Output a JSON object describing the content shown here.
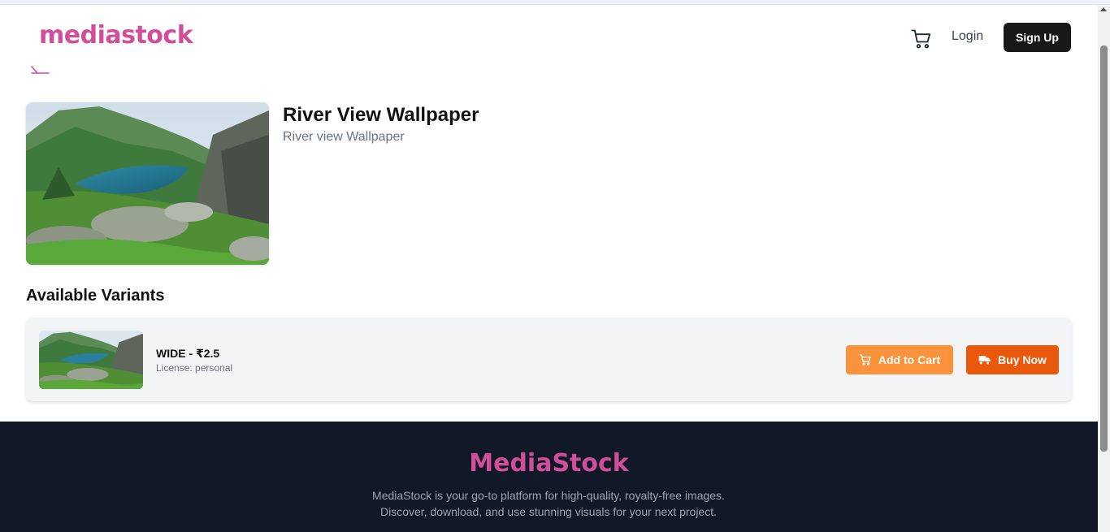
{
  "header": {
    "logo": "mediastock",
    "login_label": "Login",
    "signup_label": "Sign Up"
  },
  "product": {
    "title": "River View Wallpaper",
    "description": "River view Wallpaper"
  },
  "variants": {
    "heading": "Available Variants",
    "items": [
      {
        "name": "WIDE - ₹2.5",
        "license": "License: personal",
        "add_to_cart_label": "Add to Cart",
        "buy_now_label": "Buy Now"
      }
    ]
  },
  "footer": {
    "logo": "MediaStock",
    "description": "MediaStock is your go-to platform for high-quality, royalty-free images. Discover, download, and use stunning visuals for your next project."
  },
  "colors": {
    "brand": "#d14f9a",
    "add_to_cart": "#fb923c",
    "buy_now": "#ea580c",
    "signup": "#18181b",
    "footer_bg": "#111827"
  },
  "icons": {
    "cart": "cart-icon",
    "back": "back-arrow-icon",
    "truck": "truck-icon"
  }
}
